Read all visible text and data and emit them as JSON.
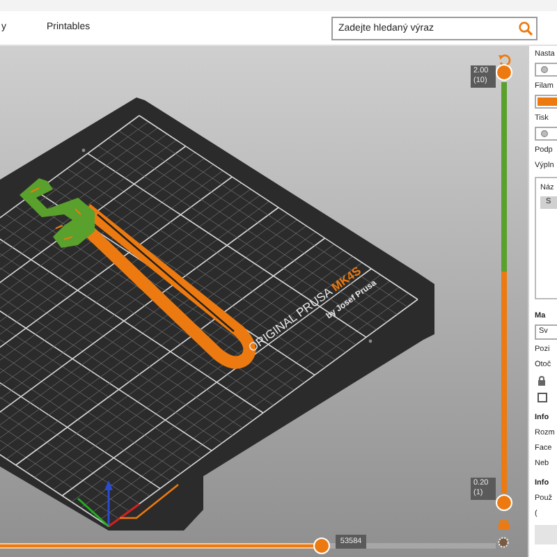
{
  "tabs": [
    {
      "label": "y",
      "selected": false
    },
    {
      "label": "Printables",
      "selected": false
    }
  ],
  "search": {
    "placeholder": "Zadejte hledaný výraz"
  },
  "bed_logo": {
    "brand": "ORIGINAL PRUSA",
    "model": "MK4S",
    "maker": "by Josef Prusa"
  },
  "vertical_slider": {
    "upper_value": "2.00",
    "upper_layer": "(10)",
    "lower_value": "0.20",
    "lower_layer": "(1)"
  },
  "horizontal_slider": {
    "value": "53584",
    "level": 0.65
  },
  "panel": [
    {
      "kind": "label",
      "text": "Nasta"
    },
    {
      "kind": "icon_combo"
    },
    {
      "kind": "label",
      "text": "Filam"
    },
    {
      "kind": "color_combo",
      "color": "#ec7a10"
    },
    {
      "kind": "label",
      "text": "Tisk"
    },
    {
      "kind": "icon_combo"
    },
    {
      "kind": "label",
      "text": "Podp"
    },
    {
      "kind": "label",
      "text": "Výpln"
    },
    {
      "kind": "list",
      "header": "Náz",
      "rows": [
        {
          "text": "S",
          "selected": true
        }
      ]
    },
    {
      "kind": "heading",
      "text": "Ma"
    },
    {
      "kind": "dropdown",
      "text": "Sv"
    },
    {
      "kind": "label",
      "text": "Pozi"
    },
    {
      "kind": "label",
      "text": "Otoč"
    },
    {
      "kind": "lock"
    },
    {
      "kind": "checkbox",
      "checked": false
    },
    {
      "kind": "heading",
      "text": "Info"
    },
    {
      "kind": "label",
      "text": "Rozm"
    },
    {
      "kind": "label",
      "text": "Face"
    },
    {
      "kind": "label",
      "text": "Neb"
    },
    {
      "kind": "heading",
      "text": "Info"
    },
    {
      "kind": "label",
      "text": "Použ"
    },
    {
      "kind": "label",
      "text": "("
    },
    {
      "kind": "button"
    }
  ]
}
